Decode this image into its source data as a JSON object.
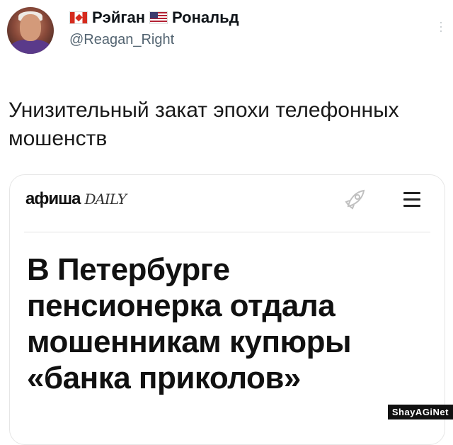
{
  "user": {
    "display_name_first": "Рэйган",
    "display_name_last": "Рональд",
    "flag_first": "canada-flag-icon",
    "flag_second": "usa-flag-icon",
    "handle": "@Reagan_Right"
  },
  "tweet": {
    "text": "Унизительный закат эпохи телефонных мошенств"
  },
  "card": {
    "logo_main": "афиша",
    "logo_sub": "DAILY",
    "headline": "В Петербурге пенсионерка отдала мошенникам купюры «банка приколов»"
  },
  "watermark": "ShayAGiNet"
}
